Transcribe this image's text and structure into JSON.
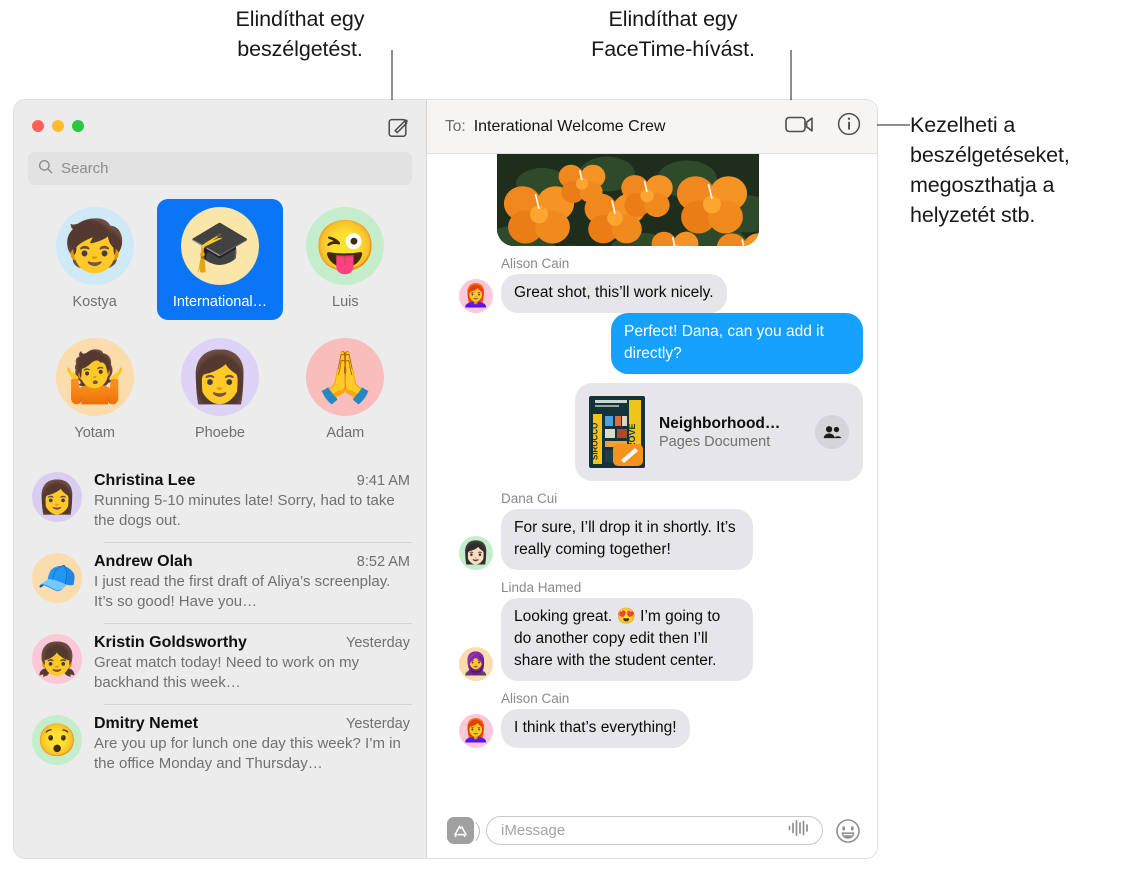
{
  "callouts": {
    "compose": "Elindíthat egy\nbeszélgetést.",
    "facetime": "Elindíthat egy\nFaceTime-hívást.",
    "details": "Kezelheti a\nbeszélgetéseket,\nmegoszthatja a\nhelyzetét stb."
  },
  "sidebar": {
    "search_placeholder": "Search",
    "compose_icon": "compose-icon",
    "traffic_lights": [
      "close",
      "minimize",
      "zoom"
    ],
    "pinned": [
      {
        "label": "Kostya",
        "emoji": "🧒",
        "bg": "#cfe9f7",
        "selected": false
      },
      {
        "label": "International…",
        "emoji": "🎓",
        "bg": "#fae6a8",
        "selected": true
      },
      {
        "label": "Luis",
        "emoji": "😜",
        "bg": "#c4eecb",
        "selected": false
      },
      {
        "label": "Yotam",
        "emoji": "🤷",
        "bg": "#fbdcad",
        "selected": false
      },
      {
        "label": "Phoebe",
        "emoji": "👩",
        "bg": "#ddd3f7",
        "selected": false
      },
      {
        "label": "Adam",
        "emoji": "🙏",
        "bg": "#f9bdbb",
        "selected": false
      }
    ],
    "conversations": [
      {
        "name": "Christina Lee",
        "time": "9:41 AM",
        "preview": "Running 5-10 minutes late! Sorry, had to take the dogs out.",
        "emoji": "👩",
        "bg": "#d9cdf2"
      },
      {
        "name": "Andrew Olah",
        "time": "8:52 AM",
        "preview": "I just read the first draft of Aliya’s screenplay. It’s so good! Have you…",
        "emoji": "🧢",
        "bg": "#fbdcad"
      },
      {
        "name": "Kristin Goldsworthy",
        "time": "Yesterday",
        "preview": "Great match today! Need to work on my backhand this week…",
        "emoji": "👧",
        "bg": "#fbc8d8"
      },
      {
        "name": "Dmitry Nemet",
        "time": "Yesterday",
        "preview": "Are you up for lunch one day this week? I’m in the office Monday and Thursday…",
        "emoji": "😯",
        "bg": "#c4eecb"
      }
    ]
  },
  "thread": {
    "to_label": "To:",
    "to_value": "Interational Welcome Crew",
    "facetime_icon": "video-camera-icon",
    "info_icon": "info-circle-icon",
    "photo_alt": "orange-flowers-photo",
    "messages": [
      {
        "type": "photo",
        "direction": "in"
      },
      {
        "type": "text",
        "direction": "in",
        "sender": "Alison Cain",
        "text": "Great shot, this’ll work nicely.",
        "emoji": "👩‍🦰",
        "bg": "#fbc8d8"
      },
      {
        "type": "text",
        "direction": "out",
        "sender": "",
        "text": "Perfect! Dana, can you add it directly?"
      },
      {
        "type": "attachment",
        "direction": "out",
        "title": "Neighborhood…",
        "subtitle": "Pages Document",
        "badge_icon": "shared-people-icon",
        "thumb_label": "SIROCCO GROVE"
      },
      {
        "type": "text",
        "direction": "in",
        "sender": "Dana Cui",
        "text": "For sure, I’ll drop it in shortly. It’s really coming together!",
        "emoji": "👩🏻",
        "bg": "#c4eecb"
      },
      {
        "type": "text",
        "direction": "in",
        "sender": "Linda Hamed",
        "text": "Looking great. 😍 I’m going to do another copy edit then I’ll share with the student center.",
        "emoji": "🧕",
        "bg": "#fbdcad"
      },
      {
        "type": "text",
        "direction": "in",
        "sender": "Alison Cain",
        "text": "I think that’s everything!",
        "emoji": "👩‍🦰",
        "bg": "#fbc8d8"
      }
    ],
    "composer": {
      "apps_icon": "app-store-icon",
      "placeholder": "iMessage",
      "audio_icon": "audio-waveform-icon",
      "emoji_icon": "smiley-face-icon"
    }
  },
  "colors": {
    "accent_blue": "#0a76f6",
    "bubble_out": "#16a0ff",
    "bubble_in": "#e6e5ea",
    "sidebar_bg": "#ececec"
  }
}
